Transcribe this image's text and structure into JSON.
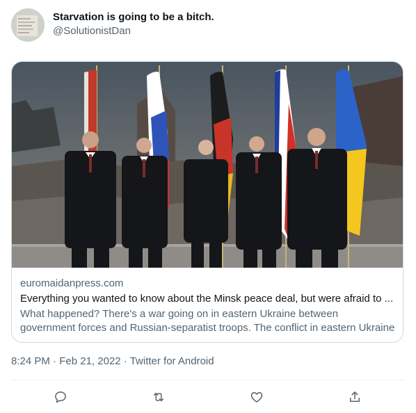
{
  "tweet": {
    "display_name": "Starvation is going to be a bitch.",
    "handle": "@SolutionistDan",
    "timestamp": "8:24 PM",
    "date": "Feb 21, 2022",
    "source": "Twitter for Android",
    "separator": "·"
  },
  "card": {
    "domain": "euromaidanpress.com",
    "title": "Everything you wanted to know about the Minsk peace deal, but were afraid to ...",
    "description": "What happened? There's a war going on in eastern Ukraine between government forces and Russian-separatist troops.  The conflict in eastern Ukraine between..."
  },
  "actions": [
    {
      "name": "reply",
      "icon": "reply-icon"
    },
    {
      "name": "retweet",
      "icon": "retweet-icon"
    },
    {
      "name": "like",
      "icon": "heart-icon"
    },
    {
      "name": "share",
      "icon": "share-icon"
    }
  ],
  "colors": {
    "text": "#0f1419",
    "secondary": "#536471",
    "border": "#cfd9de",
    "divider": "#eff3f4"
  }
}
